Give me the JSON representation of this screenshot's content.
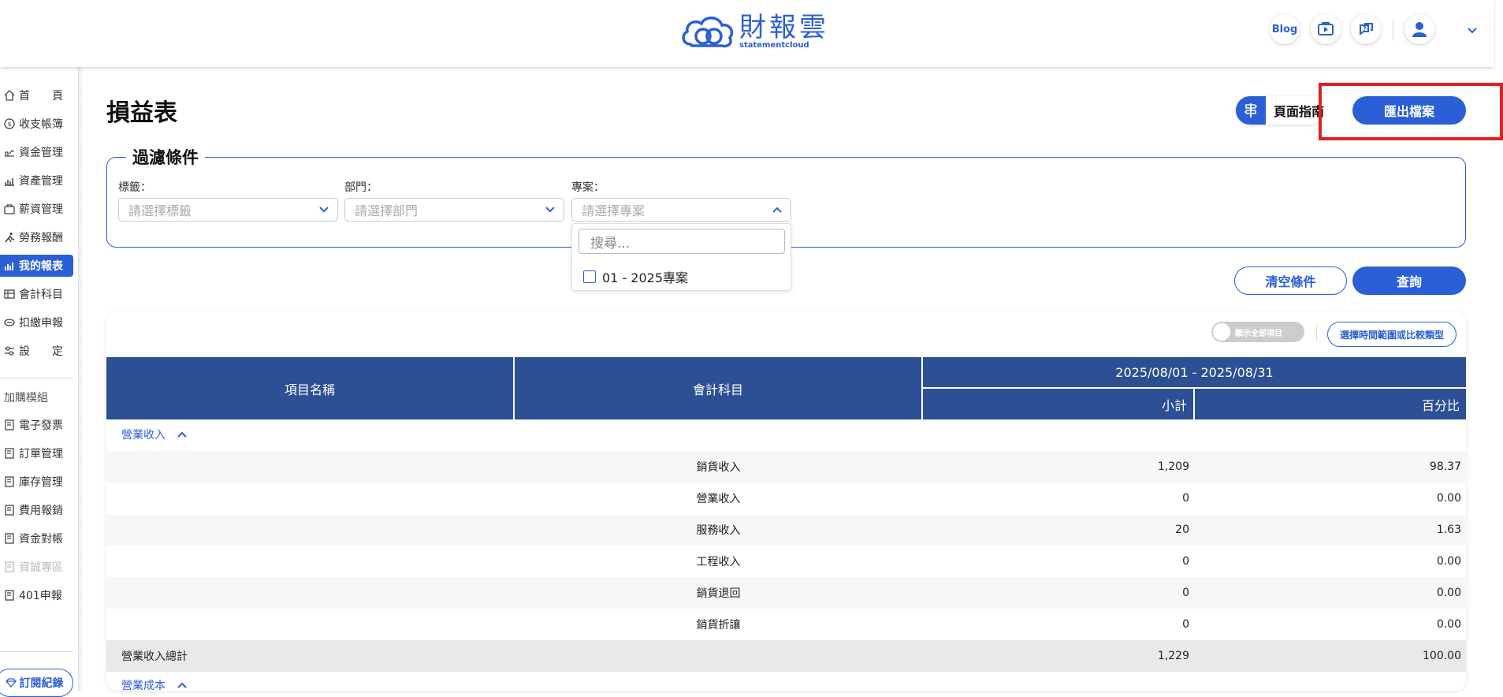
{
  "header": {
    "logo_text": "財報雲",
    "logo_sub": "statementcloud",
    "blog_label": "Blog",
    "icons": [
      "video-tutorial-icon",
      "help-chat-icon",
      "user-icon",
      "chevron-down-icon"
    ]
  },
  "sidebar": {
    "items": [
      {
        "label": "首　　頁",
        "icon": "home-icon"
      },
      {
        "label": "收支帳簿",
        "icon": "coin-icon"
      },
      {
        "label": "資金管理",
        "icon": "fund-icon"
      },
      {
        "label": "資產管理",
        "icon": "asset-icon"
      },
      {
        "label": "薪資管理",
        "icon": "salary-icon"
      },
      {
        "label": "勞務報酬",
        "icon": "labor-icon"
      },
      {
        "label": "我的報表",
        "icon": "report-icon"
      },
      {
        "label": "會計科目",
        "icon": "ledger-icon"
      },
      {
        "label": "扣繳申報",
        "icon": "tax-icon"
      },
      {
        "label": "設　　定",
        "icon": "settings-icon"
      }
    ],
    "addon_title": "加購模組",
    "addons": [
      {
        "label": "電子發票"
      },
      {
        "label": "訂單管理"
      },
      {
        "label": "庫存管理"
      },
      {
        "label": "費用報銷"
      },
      {
        "label": "資金對帳"
      },
      {
        "label": "資誠專區"
      },
      {
        "label": "401申報"
      }
    ],
    "subscription_label": "訂閱紀錄"
  },
  "page": {
    "title": "損益表",
    "guide_label": "頁面指南",
    "export_label": "匯出檔案"
  },
  "filters": {
    "legend": "過濾條件",
    "tag_label": "標籤：",
    "tag_placeholder": "請選擇標籤",
    "dept_label": "部門：",
    "dept_placeholder": "請選擇部門",
    "project_label": "專案：",
    "project_placeholder": "請選擇專案",
    "search_placeholder": "搜尋...",
    "project_option": "01 - 2025專案",
    "clear_label": "清空條件",
    "query_label": "查詢"
  },
  "report": {
    "toggle_label": "顯示全部項目",
    "range_label": "選擇時間範圍或比較類型",
    "col_item": "項目名稱",
    "col_account": "會計科目",
    "period": "2025/08/01 - 2025/08/31",
    "col_subtotal": "小計",
    "col_percent": "百分比",
    "section1": "營業收入",
    "rows": [
      {
        "account": "銷貨收入",
        "subtotal": "1,209",
        "percent": "98.37"
      },
      {
        "account": "營業收入",
        "subtotal": "0",
        "percent": "0.00"
      },
      {
        "account": "服務收入",
        "subtotal": "20",
        "percent": "1.63"
      },
      {
        "account": "工程收入",
        "subtotal": "0",
        "percent": "0.00"
      },
      {
        "account": "銷貨退回",
        "subtotal": "0",
        "percent": "0.00"
      },
      {
        "account": "銷貨折讓",
        "subtotal": "0",
        "percent": "0.00"
      }
    ],
    "total_label": "營業收入總計",
    "total_subtotal": "1,229",
    "total_percent": "100.00",
    "section2": "營業成本"
  },
  "colors": {
    "accent": "#2a5fd6",
    "table_header": "#2d4f94",
    "highlight": "#e02020"
  }
}
